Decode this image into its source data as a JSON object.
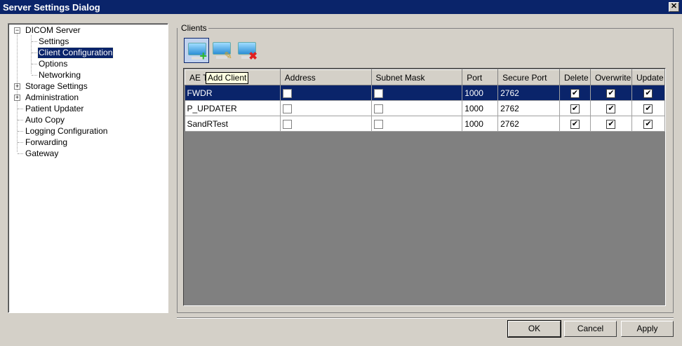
{
  "window": {
    "title": "Server Settings Dialog",
    "close_icon": "close-icon"
  },
  "tree": {
    "dicom": "DICOM Server",
    "children": [
      "Settings",
      "Client Configuration",
      "Options",
      "Networking"
    ],
    "selected": "Client Configuration",
    "top": [
      "Storage Settings",
      "Administration",
      "Patient Updater",
      "Auto Copy",
      "Logging Configuration",
      "Forwarding",
      "Gateway"
    ]
  },
  "clients": {
    "group_title": "Clients",
    "toolbar": {
      "add_icon": "add-client-icon",
      "edit_icon": "edit-client-icon",
      "delete_icon": "delete-client-icon"
    },
    "tooltip": "Add Client",
    "columns": [
      "AE Title",
      "Address",
      "Subnet Mask",
      "Port",
      "Secure Port",
      "Delete",
      "Overwrite",
      "Update"
    ],
    "rows": [
      {
        "ae": "FWDR",
        "address": false,
        "subnet": false,
        "port": "1000",
        "secure_port": "2762",
        "delete": true,
        "overwrite": true,
        "update": true,
        "selected": true
      },
      {
        "ae": "P_UPDATER",
        "address": false,
        "subnet": false,
        "port": "1000",
        "secure_port": "2762",
        "delete": true,
        "overwrite": true,
        "update": true
      },
      {
        "ae": "SandRTest",
        "address": false,
        "subnet": false,
        "port": "1000",
        "secure_port": "2762",
        "delete": true,
        "overwrite": true,
        "update": true
      }
    ]
  },
  "buttons": {
    "ok": "OK",
    "cancel": "Cancel",
    "apply": "Apply"
  },
  "colors": {
    "titlebar": "#0a246a",
    "selection": "#0a246a",
    "face": "#d4d0c8"
  }
}
